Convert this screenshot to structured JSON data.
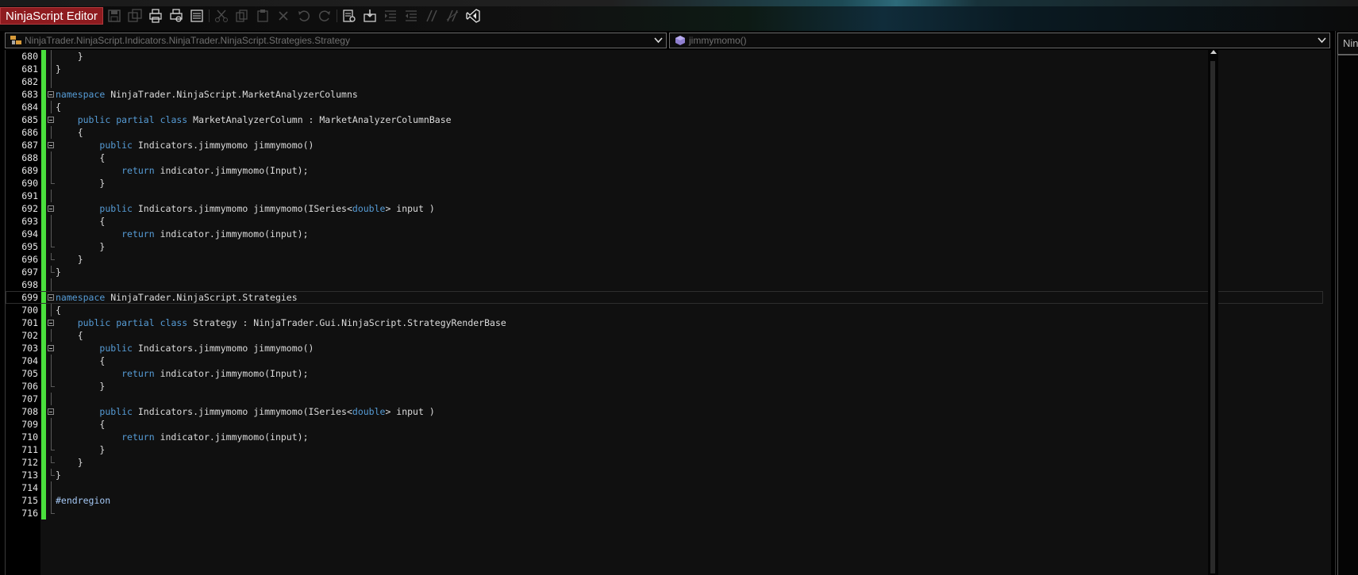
{
  "app": {
    "title": "NinjaScript Editor"
  },
  "toolbar": {
    "icons": [
      "save-icon",
      "save-all-icon",
      "print-icon",
      "print-preview-icon",
      "page-setup-icon",
      "cut-icon",
      "copy-icon",
      "paste-icon",
      "delete-icon",
      "undo-icon",
      "redo-icon",
      "find-icon",
      "compile-icon",
      "indent-icon",
      "outdent-icon",
      "comment-icon",
      "uncomment-icon",
      "visual-studio-icon"
    ]
  },
  "class_dropdown": {
    "value": "NinjaTrader.NinjaScript.Indicators.NinjaTrader.NinjaScript.Strategies.Strategy"
  },
  "member_dropdown": {
    "value": "jimmymomo()"
  },
  "right_panel": {
    "tab_label": "Ninja"
  },
  "colors": {
    "title_bg": "#8e1b1f",
    "change_bar": "#4ae03d",
    "keyword": "#569cd6",
    "editor_bg": "#101010"
  },
  "editor": {
    "lines": [
      {
        "n": "680",
        "text": "    }"
      },
      {
        "n": "681",
        "text": "}"
      },
      {
        "n": "682",
        "text": ""
      },
      {
        "n": "683",
        "text": "namespace NinjaTrader.NinjaScript.MarketAnalyzerColumns"
      },
      {
        "n": "684",
        "text": "{"
      },
      {
        "n": "685",
        "text": "    public partial class MarketAnalyzerColumn : MarketAnalyzerColumnBase"
      },
      {
        "n": "686",
        "text": "    {"
      },
      {
        "n": "687",
        "text": "        public Indicators.jimmymomo jimmymomo()"
      },
      {
        "n": "688",
        "text": "        {"
      },
      {
        "n": "689",
        "text": "            return indicator.jimmymomo(Input);"
      },
      {
        "n": "690",
        "text": "        }"
      },
      {
        "n": "691",
        "text": ""
      },
      {
        "n": "692",
        "text": "        public Indicators.jimmymomo jimmymomo(ISeries<double> input )"
      },
      {
        "n": "693",
        "text": "        {"
      },
      {
        "n": "694",
        "text": "            return indicator.jimmymomo(input);"
      },
      {
        "n": "695",
        "text": "        }"
      },
      {
        "n": "696",
        "text": "    }"
      },
      {
        "n": "697",
        "text": "}"
      },
      {
        "n": "698",
        "text": ""
      },
      {
        "n": "699",
        "text": "namespace NinjaTrader.NinjaScript.Strategies"
      },
      {
        "n": "700",
        "text": "{"
      },
      {
        "n": "701",
        "text": "    public partial class Strategy : NinjaTrader.Gui.NinjaScript.StrategyRenderBase"
      },
      {
        "n": "702",
        "text": "    {"
      },
      {
        "n": "703",
        "text": "        public Indicators.jimmymomo jimmymomo()"
      },
      {
        "n": "704",
        "text": "        {"
      },
      {
        "n": "705",
        "text": "            return indicator.jimmymomo(Input);"
      },
      {
        "n": "706",
        "text": "        }"
      },
      {
        "n": "707",
        "text": ""
      },
      {
        "n": "708",
        "text": "        public Indicators.jimmymomo jimmymomo(ISeries<double> input )"
      },
      {
        "n": "709",
        "text": "        {"
      },
      {
        "n": "710",
        "text": "            return indicator.jimmymomo(input);"
      },
      {
        "n": "711",
        "text": "        }"
      },
      {
        "n": "712",
        "text": "    }"
      },
      {
        "n": "713",
        "text": "}"
      },
      {
        "n": "714",
        "text": ""
      },
      {
        "n": "715",
        "text": "#endregion"
      },
      {
        "n": "716",
        "text": ""
      }
    ],
    "current_line": "699"
  }
}
